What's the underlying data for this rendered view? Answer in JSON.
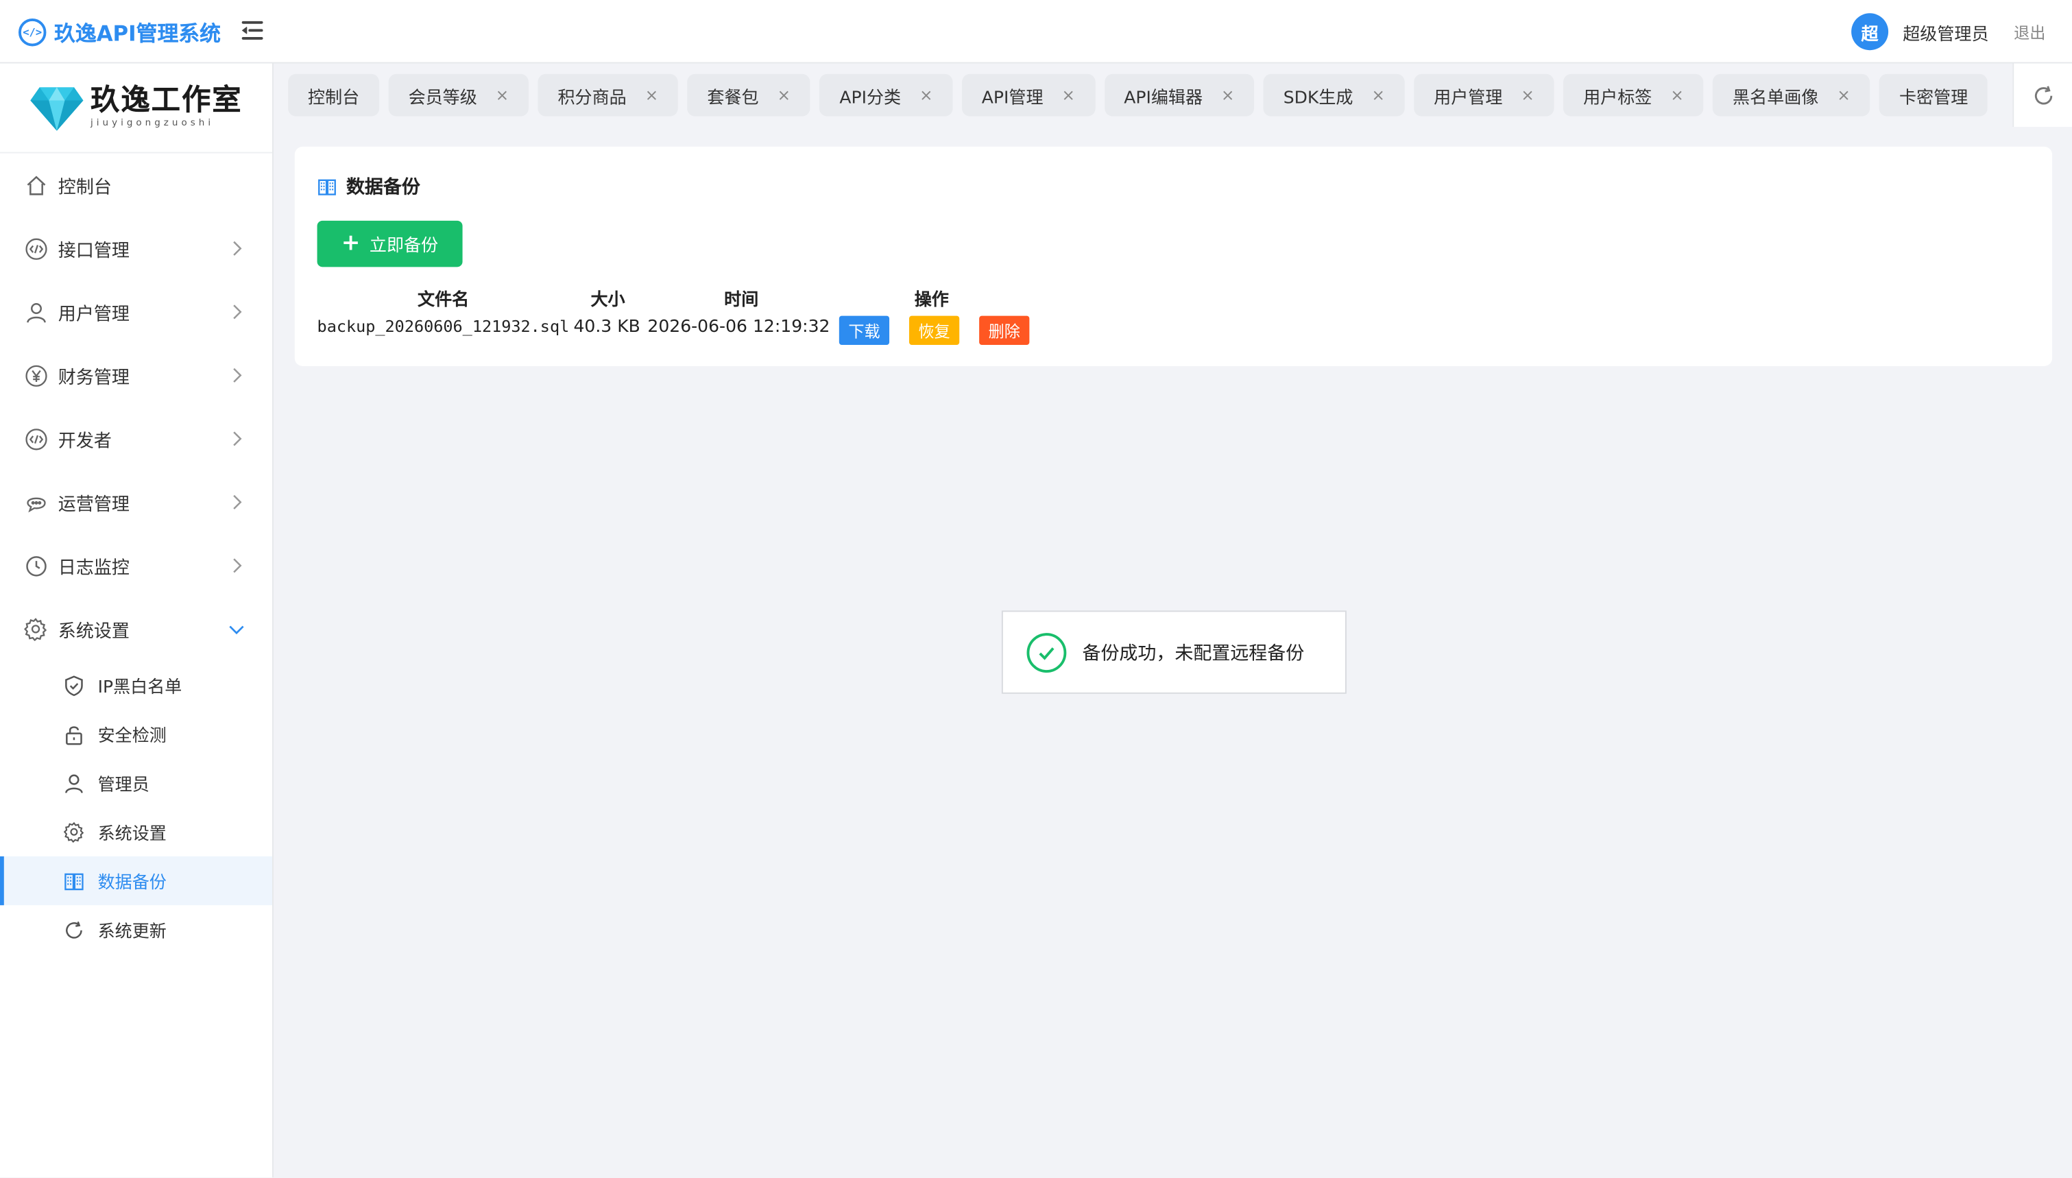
{
  "header": {
    "app_title": "玖逸API管理系统",
    "brand_icon_text": "</>",
    "avatar_text": "超",
    "username": "超级管理员",
    "logout": "退出",
    "accent_color": "#2d8cf0"
  },
  "sidebar": {
    "logo_main": "玖逸工作室",
    "logo_sub": "jiuyigongzuoshi",
    "items": [
      {
        "label": "控制台",
        "icon": "home-icon"
      },
      {
        "label": "接口管理",
        "icon": "code-icon"
      },
      {
        "label": "用户管理",
        "icon": "user-icon"
      },
      {
        "label": "财务管理",
        "icon": "yen-icon"
      },
      {
        "label": "开发者",
        "icon": "code-icon"
      },
      {
        "label": "运营管理",
        "icon": "chat-icon"
      },
      {
        "label": "日志监控",
        "icon": "clock-icon"
      },
      {
        "label": "系统设置",
        "icon": "gear-icon"
      }
    ],
    "subitems": [
      {
        "label": "IP黑白名单",
        "icon": "shield-icon"
      },
      {
        "label": "安全检测",
        "icon": "lock-icon"
      },
      {
        "label": "管理员",
        "icon": "user-icon"
      },
      {
        "label": "系统设置",
        "icon": "gear-icon"
      },
      {
        "label": "数据备份",
        "icon": "book-icon",
        "active": true
      },
      {
        "label": "系统更新",
        "icon": "refresh-icon"
      }
    ]
  },
  "tabs": [
    {
      "label": "控制台",
      "closable": false
    },
    {
      "label": "会员等级",
      "closable": true
    },
    {
      "label": "积分商品",
      "closable": true
    },
    {
      "label": "套餐包",
      "closable": true
    },
    {
      "label": "API分类",
      "closable": true
    },
    {
      "label": "API管理",
      "closable": true
    },
    {
      "label": "API编辑器",
      "closable": true
    },
    {
      "label": "SDK生成",
      "closable": true
    },
    {
      "label": "用户管理",
      "closable": true
    },
    {
      "label": "用户标签",
      "closable": true
    },
    {
      "label": "黑名单画像",
      "closable": true
    },
    {
      "label": "卡密管理",
      "closable": false
    }
  ],
  "tab_close_glyph": "×",
  "card": {
    "title": "数据备份",
    "backup_button": "立即备份",
    "columns": [
      "文件名",
      "大小",
      "时间",
      "操作"
    ],
    "rows": [
      {
        "file": "backup_20260606_121932.sql",
        "size": "40.3 KB",
        "time": "2026-06-06 12:19:32",
        "actions": {
          "download": "下载",
          "restore": "恢复",
          "delete": "删除"
        }
      }
    ],
    "action_colors": {
      "download": "#2d8cf0",
      "restore": "#ffb400",
      "delete": "#ff5722"
    },
    "button_color": "#19be6b"
  },
  "toast": {
    "message": "备份成功，未配置远程备份"
  }
}
